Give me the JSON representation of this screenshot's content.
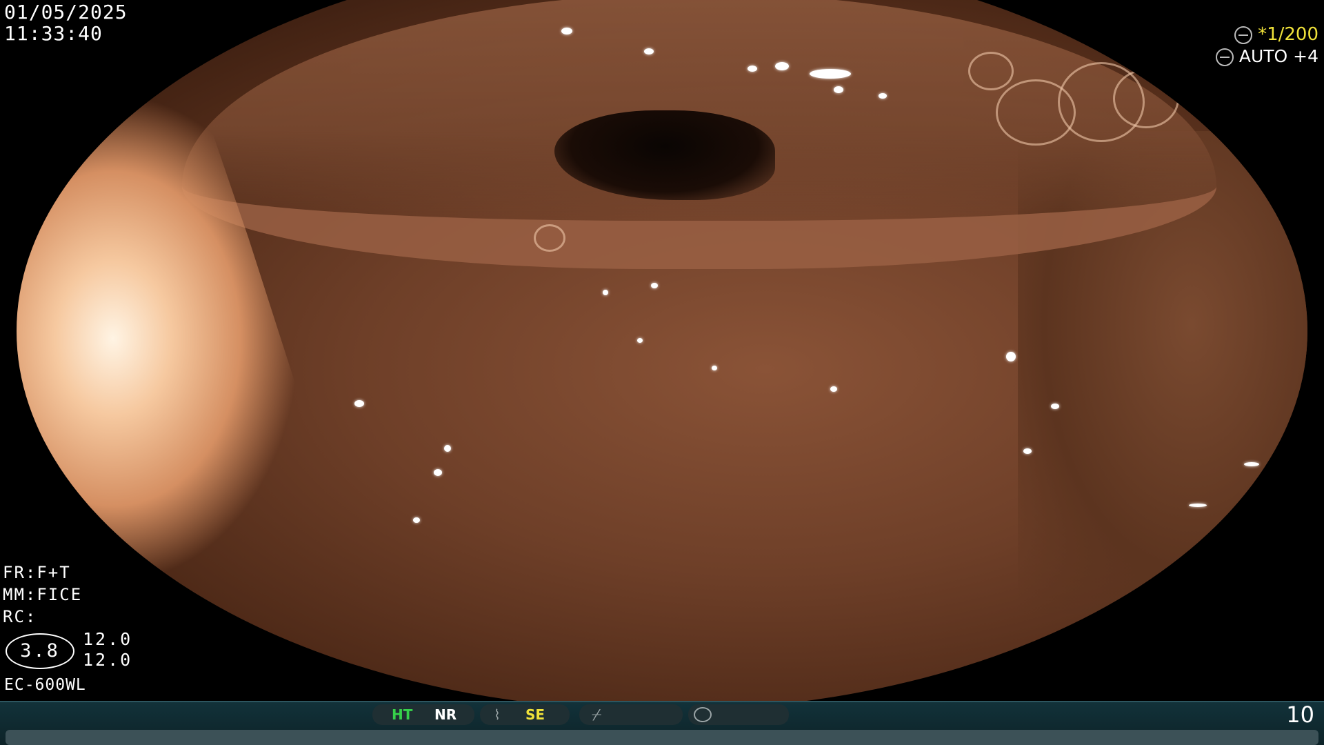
{
  "overlay": {
    "date": "01/05/2025",
    "time": "11:33:40",
    "shutter_prefix": "*",
    "shutter_value": "1/200",
    "exposure_mode": "AUTO +4",
    "fr": "FR:F+T",
    "mm": "MM:FICE",
    "rc": "RC:",
    "zoom_circle": "3.8",
    "zoom_value_1": "12.0",
    "zoom_value_2": "12.0",
    "scope_model": "EC-600WL"
  },
  "status_bar": {
    "ht_label": "HT",
    "nr_label": "NR",
    "se_label": "SE",
    "frame_count": "10",
    "colors": {
      "ht": "#36d14a",
      "se": "#f0e23a",
      "bar_bg": "#12323a"
    },
    "icons": [
      "iris-icon",
      "brightness-icon",
      "structure-enhance-icon",
      "slash-icon",
      "circle-icon"
    ]
  }
}
